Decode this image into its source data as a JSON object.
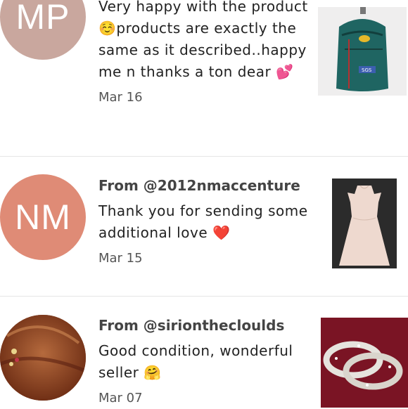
{
  "reviews": [
    {
      "initials": "MP",
      "avatar_color": "#c9a79e",
      "from": "",
      "message": "Very happy with the product ☺️products are exactly the same as it described..happy me n thanks a ton dear 💕",
      "date": "Mar 16",
      "item": "teal backpack"
    },
    {
      "initials": "NM",
      "avatar_color": "#df8b76",
      "from": "From @2012nmaccenture",
      "message": "Thank you for sending some additional love ❤️",
      "date": "Mar 15",
      "item": "blush cold-shoulder dress"
    },
    {
      "initials": "",
      "avatar_color": "#8a3f22",
      "from": "From @sirionthecloulds",
      "message": "Good condition, wonderful seller 🤗",
      "date": "Mar 07",
      "item": "silver bangles"
    }
  ]
}
